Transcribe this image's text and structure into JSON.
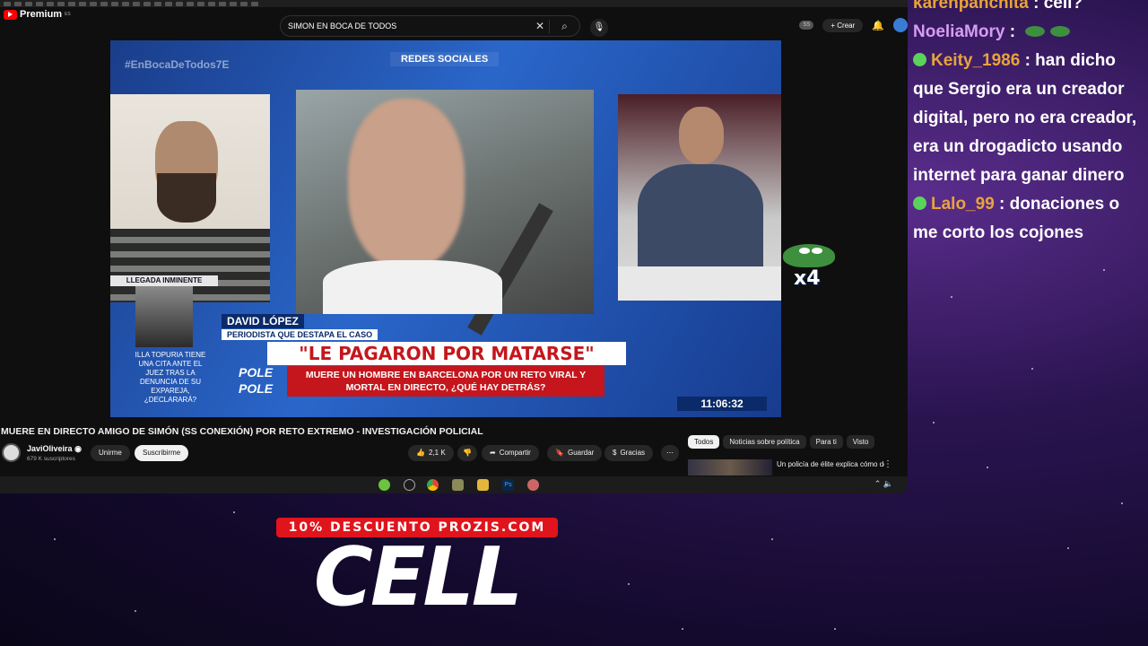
{
  "browser": {
    "logo_text": "Premium",
    "logo_region": "ES",
    "search_value": "SIMON EN BOCA DE TODOS",
    "header_badge": "SS",
    "create_label": "Crear"
  },
  "video": {
    "hashtag": "#EnBocaDeTodos7E",
    "section_label": "REDES SOCIALES",
    "llegada_label": "LLEGADA INMINENTE",
    "llegada_text": "ILLA TOPURIA TIENE UNA CITA ANTE EL JUEZ TRAS LA DENUNCIA DE SU EXPAREJA, ¿DECLARARÁ?",
    "guest_name": "DAVID LÓPEZ",
    "guest_role": "PERIODISTA QUE DESTAPA EL CASO",
    "headline": "\"LE PAGARON POR MATARSE\"",
    "subheadline": "MUERE UN HOMBRE EN BARCELONA POR UN RETO VIRAL Y MORTAL EN DIRECTO, ¿QUÉ HAY DETRÁS?",
    "pole_text": "POLE",
    "clock": "11:06:32",
    "overlay_multiplier": "x4"
  },
  "watch": {
    "title": "MUERE EN DIRECTO AMIGO DE SIMÓN (SS CONEXIÓN) POR RETO EXTREMO - INVESTIGACIÓN POLICIAL",
    "channel_name": "JaviOliveira",
    "channel_subs": "679 K suscriptores",
    "join_label": "Unirme",
    "subscribe_label": "Suscribirme",
    "likes": "2,1 K",
    "share_label": "Compartir",
    "save_label": "Guardar",
    "thanks_label": "Gracias",
    "chips": [
      "Todos",
      "Noticias sobre política",
      "Para ti",
      "Visto"
    ],
    "rec_title": "Un policía de élite explica cómo detener a un narco |"
  },
  "chat": [
    {
      "user": "karenpanchita",
      "text": ": cell?",
      "color": "#e8a33c",
      "badge": false
    },
    {
      "user": "NoeliaMory",
      "text": ":",
      "color": "#d79cf3",
      "badge": false,
      "emotes": 2
    },
    {
      "user": "Keity_1986",
      "text": ": han dicho que Sergio era un creador digital, pero no era creador, era un drogadicto usando internet para ganar dinero",
      "color": "#e8a33c",
      "badge": true
    },
    {
      "user": "Lalo_99",
      "text": ": donaciones o me corto los cojones",
      "color": "#e8a33c",
      "badge": true
    }
  ],
  "promo": {
    "banner": "10% DESCUENTO PROZIS.COM",
    "command": "CELL"
  },
  "colors": {
    "yt_red": "#ff0000",
    "news_red": "#c4161c",
    "news_blue": "#0b2a69",
    "chat_username": "#e8a33c",
    "chat_username_alt": "#d79cf3"
  }
}
